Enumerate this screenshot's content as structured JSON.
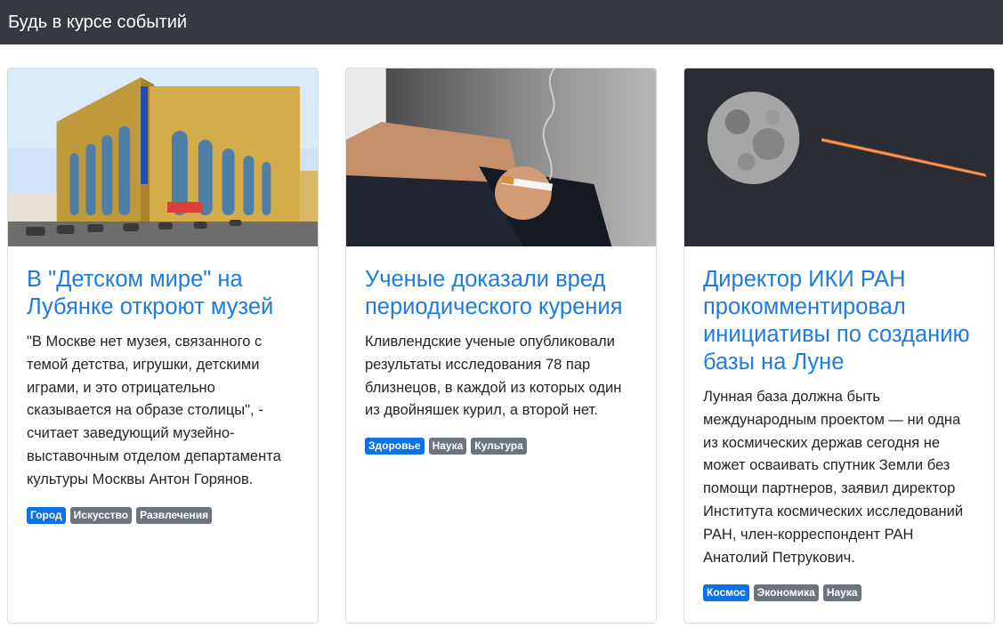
{
  "navbar": {
    "title": "Будь в курсе событий"
  },
  "cards": [
    {
      "image_alt": "Детский мир building",
      "title": "В \"Детском мире\" на Лубянке откроют музей",
      "text": "\"В Москве нет музея, связанного с темой детства, игрушки, детскими играми, и это отрицательно сказывается на образе столицы\", - считает заведующий музейно-выставочным отделом департамента культуры Москвы Антон Горянов.",
      "tags": [
        "Город",
        "Искусство",
        "Развлечения"
      ]
    },
    {
      "image_alt": "hand holding cigarette",
      "title": "Ученые доказали вред периодического курения",
      "text": "Кливлендские ученые опубликовали результаты исследования 78 пар близнецов, в каждой из которых один из двойняшек курил, а второй нет.",
      "tags": [
        "Здоровье",
        "Наука",
        "Культура"
      ]
    },
    {
      "image_alt": "moon and rocket trail",
      "title": "Директор ИКИ РАН прокомментировал инициативы по созданию базы на Луне",
      "text": "Лунная база должна быть международным проектом — ни одна из космических держав сегодня не может осваивать спутник Земли без помощи партнеров, заявил директор Института космических исследований РАН, член-корреспондент РАН Анатолий Петрукович.",
      "tags": [
        "Космос",
        "Экономика",
        "Наука"
      ]
    }
  ],
  "colors": {
    "navbar_bg": "#343a40",
    "title_link": "#1e7be0",
    "badge_primary": "#0d72e6",
    "badge_secondary": "#6c757d"
  }
}
